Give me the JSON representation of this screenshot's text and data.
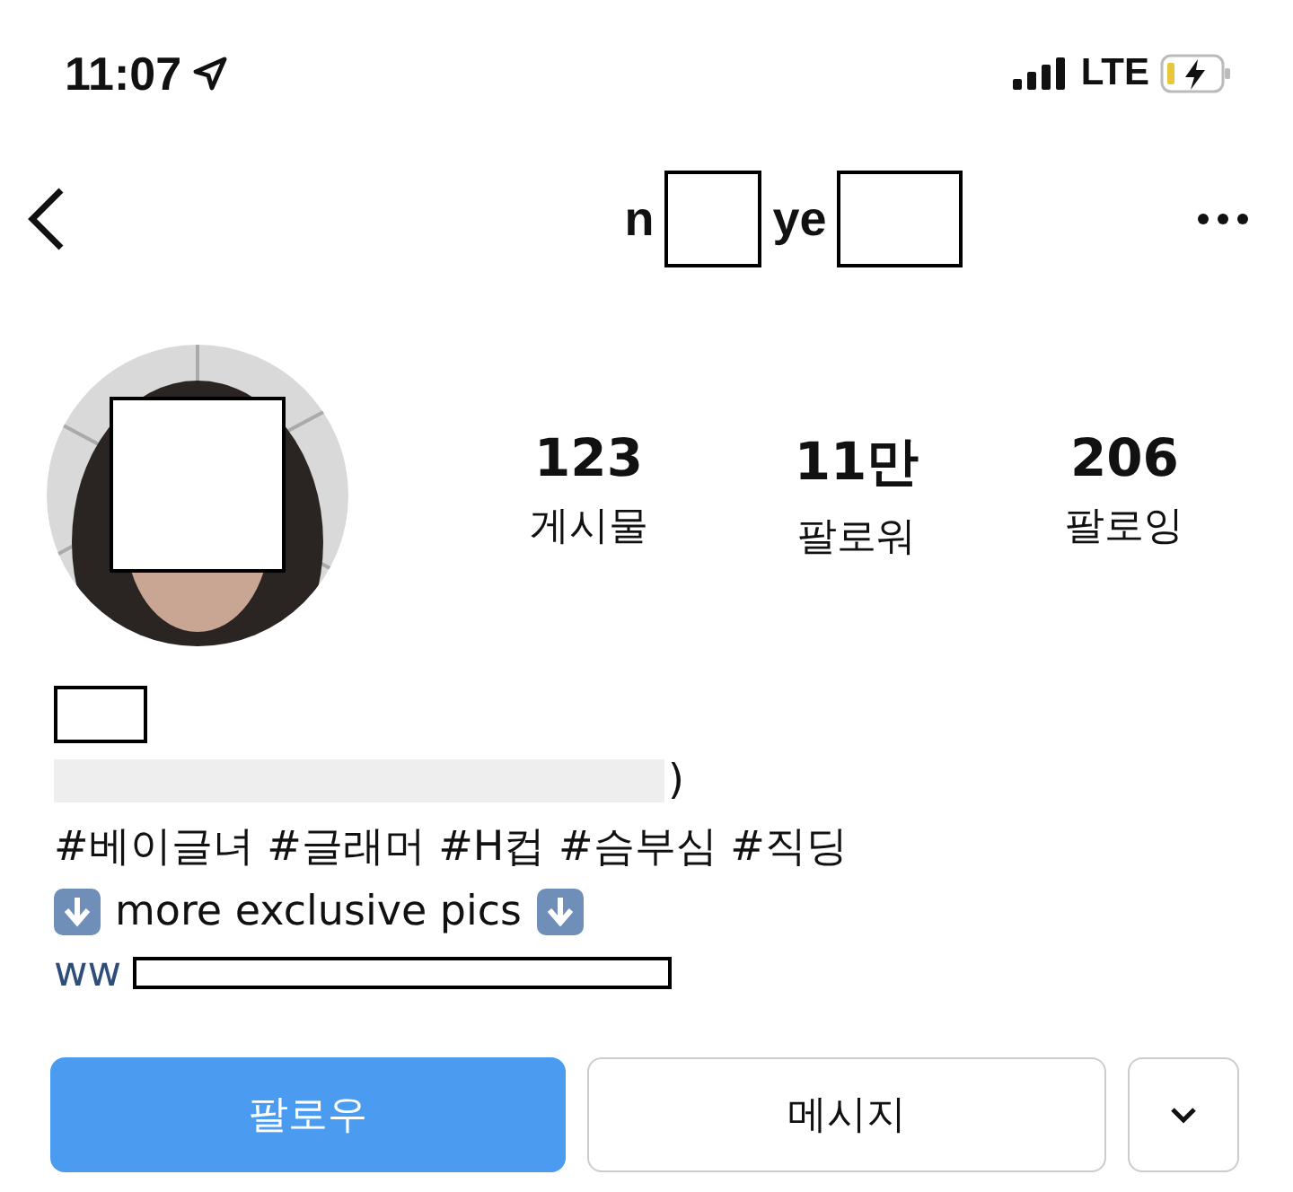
{
  "status_bar": {
    "time": "11:07",
    "network": "LTE"
  },
  "nav": {
    "title_parts": [
      "n",
      "ye"
    ]
  },
  "stats": [
    {
      "value": "123",
      "label": "게시물"
    },
    {
      "value": "11만",
      "label": "팔로워"
    },
    {
      "value": "206",
      "label": "팔로잉"
    }
  ],
  "bio": {
    "line_1_end": ")",
    "hashtags": "#베이글녀 #글래머 #H컵 #슴부심 #직딩",
    "promo": "more exclusive pics",
    "link_start": "ww"
  },
  "buttons": {
    "follow": "팔로우",
    "message": "메시지"
  }
}
